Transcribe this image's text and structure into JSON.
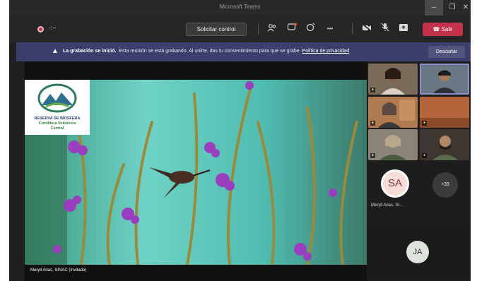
{
  "window": {
    "title": "Microsoft Teams"
  },
  "toolbar": {
    "timer": "-:--",
    "request_control": "Solicitar control",
    "more": "•••",
    "leave_label": "Salir"
  },
  "banner": {
    "bold": "La grabación se inició.",
    "message": "Esta reunión se está grabando. Al unirte, das tu consentimiento para que se grabe.",
    "link": "Política de privacidad",
    "dismiss": "Descartar"
  },
  "stage": {
    "speaker_name": "Meryll Arias, SINAC (Invitado)",
    "logo_line1": "RESERVA DE BIOSFERA",
    "logo_line2": "Cordillera Volcánica",
    "logo_line3": "Central"
  },
  "participants": {
    "sa_initials": "SA",
    "sa_name": "Meryll Arias, SI...",
    "more_count": "+39",
    "ja_initials": "JA"
  },
  "colors": {
    "leave": "#c4314b",
    "banner": "#3c3e6c",
    "accent_border": "#8a8fc8"
  },
  "icons": [
    "participants-icon",
    "chat-icon",
    "reactions-icon",
    "camera-off-icon",
    "mic-off-icon",
    "share-icon",
    "phone-icon",
    "warning-icon"
  ]
}
